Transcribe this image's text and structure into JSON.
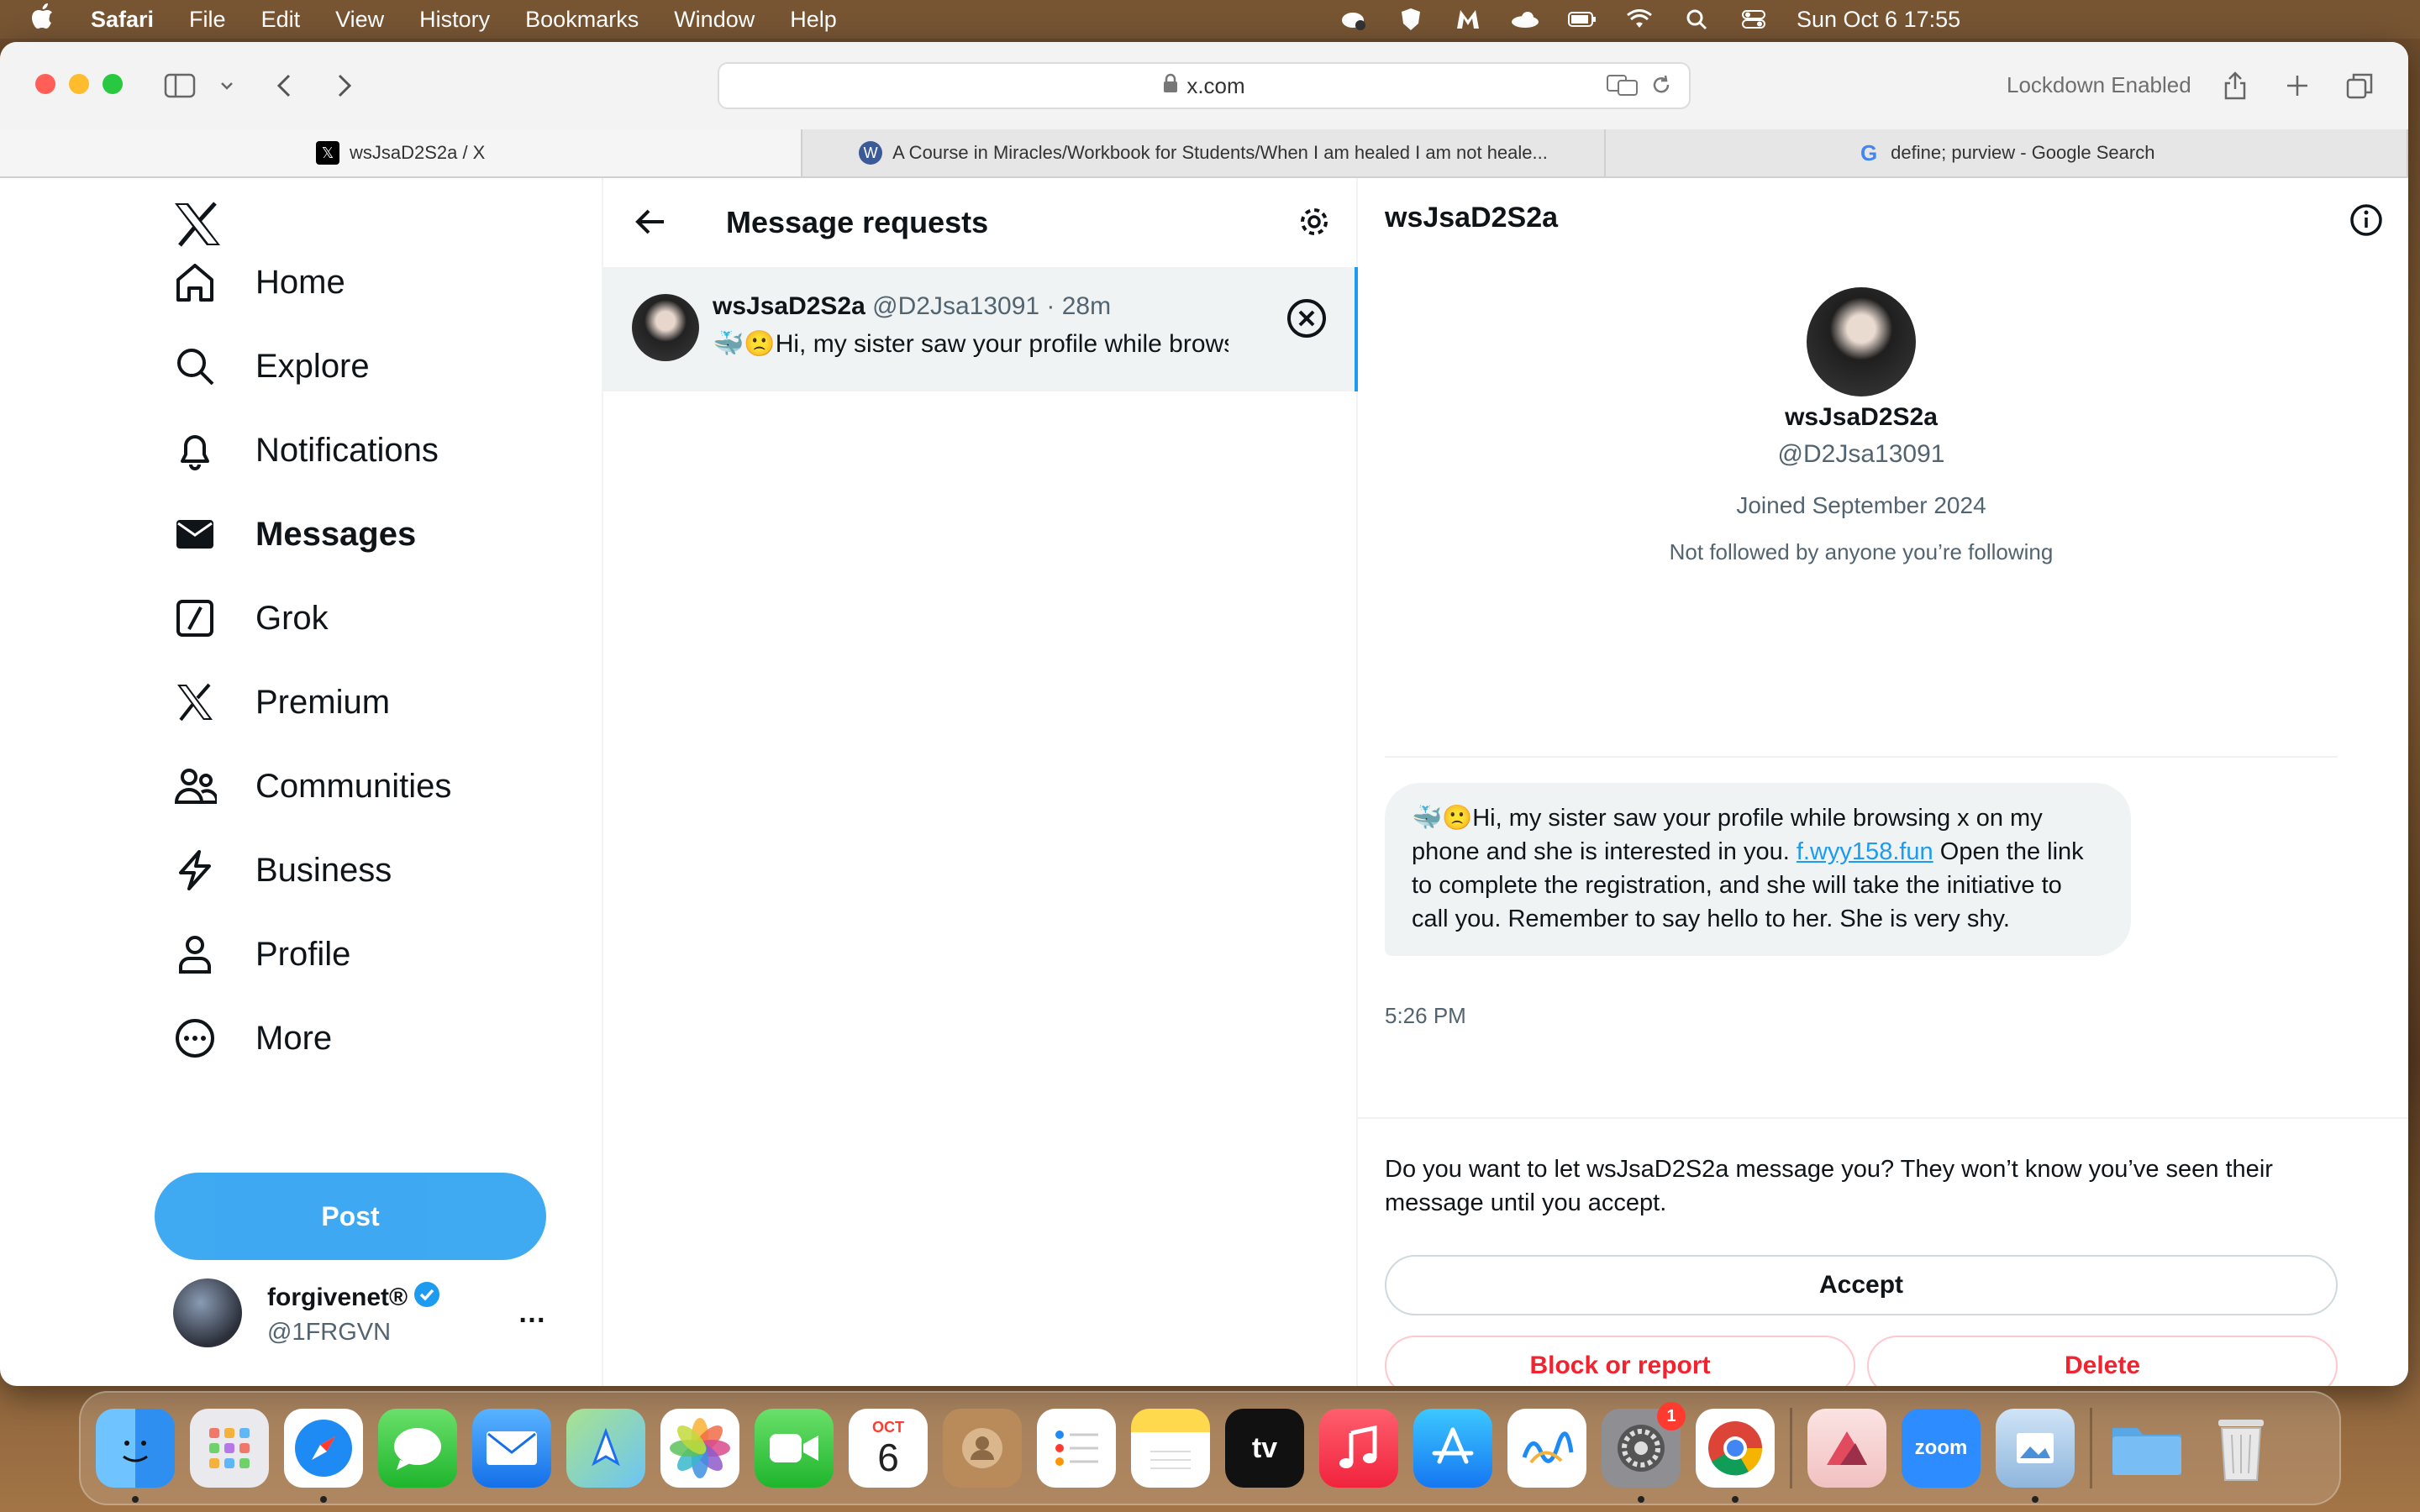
{
  "menubar": {
    "app": "Safari",
    "items": [
      "File",
      "Edit",
      "View",
      "History",
      "Bookmarks",
      "Window",
      "Help"
    ],
    "clock": "Sun Oct 6  17:55"
  },
  "browser": {
    "url": "x.com",
    "lockdown": "Lockdown Enabled",
    "tabs": [
      {
        "title": "wsJsaD2S2a / X"
      },
      {
        "title": "A Course in Miracles/Workbook for Students/When I am healed I am not heale..."
      },
      {
        "title": "define; purview - Google Search"
      }
    ]
  },
  "nav": {
    "items": [
      {
        "label": "Home",
        "icon": "home-icon"
      },
      {
        "label": "Explore",
        "icon": "search-icon"
      },
      {
        "label": "Notifications",
        "icon": "bell-icon"
      },
      {
        "label": "Messages",
        "icon": "envelope-icon"
      },
      {
        "label": "Grok",
        "icon": "grok-icon"
      },
      {
        "label": "Premium",
        "icon": "x-icon"
      },
      {
        "label": "Communities",
        "icon": "people-icon"
      },
      {
        "label": "Business",
        "icon": "lightning-icon"
      },
      {
        "label": "Profile",
        "icon": "person-icon"
      },
      {
        "label": "More",
        "icon": "more-circle-icon"
      }
    ],
    "post_label": "Post",
    "account": {
      "display_name": "forgivenet®",
      "handle": "@1FRGVN",
      "menu": "…"
    }
  },
  "requests": {
    "title": "Message requests",
    "item": {
      "display_name": "wsJsaD2S2a",
      "meta": "@D2Jsa13091 · 28m",
      "preview": "🐳🙁Hi, my sister saw your profile while browsing x on my phone and she is interested in you."
    }
  },
  "conversation": {
    "header_name": "wsJsaD2S2a",
    "profile": {
      "name": "wsJsaD2S2a",
      "handle": "@D2Jsa13091",
      "joined": "Joined September 2024",
      "followed": "Not followed by anyone you’re following"
    },
    "message": {
      "text_before": "🐳🙁Hi, my sister saw your profile while browsing x on my phone and she is interested in you.  ",
      "link": "f.wyy158.fun",
      "text_after": "  Open the link to complete the registration, and she will take the initiative to call you.  Remember to say hello to her.  She is very shy.",
      "time": "5:26 PM"
    },
    "prompt": "Do you want to let wsJsaD2S2a message you? They won’t know you’ve seen their message until you accept.",
    "accept": "Accept",
    "block": "Block or report",
    "delete": "Delete"
  },
  "dock": {
    "apps": [
      "Finder",
      "Launchpad",
      "Safari",
      "Messages",
      "Mail",
      "Maps",
      "Photos",
      "FaceTime",
      "Calendar",
      "Contacts",
      "Reminders",
      "Notes",
      "TV",
      "Music",
      "App Store",
      "Freeform",
      "System Settings",
      "Chrome",
      "Affinity",
      "Zoom",
      "Preview",
      "Folder",
      "Trash"
    ],
    "calendar_month": "OCT",
    "calendar_day": "6",
    "tv_label": "tv",
    "zoom_label": "zoom",
    "settings_badge": "1"
  },
  "colors": {
    "accent": "#1d9bf0",
    "danger": "#f4212e",
    "text": "#0f1419",
    "muted": "#536471"
  }
}
